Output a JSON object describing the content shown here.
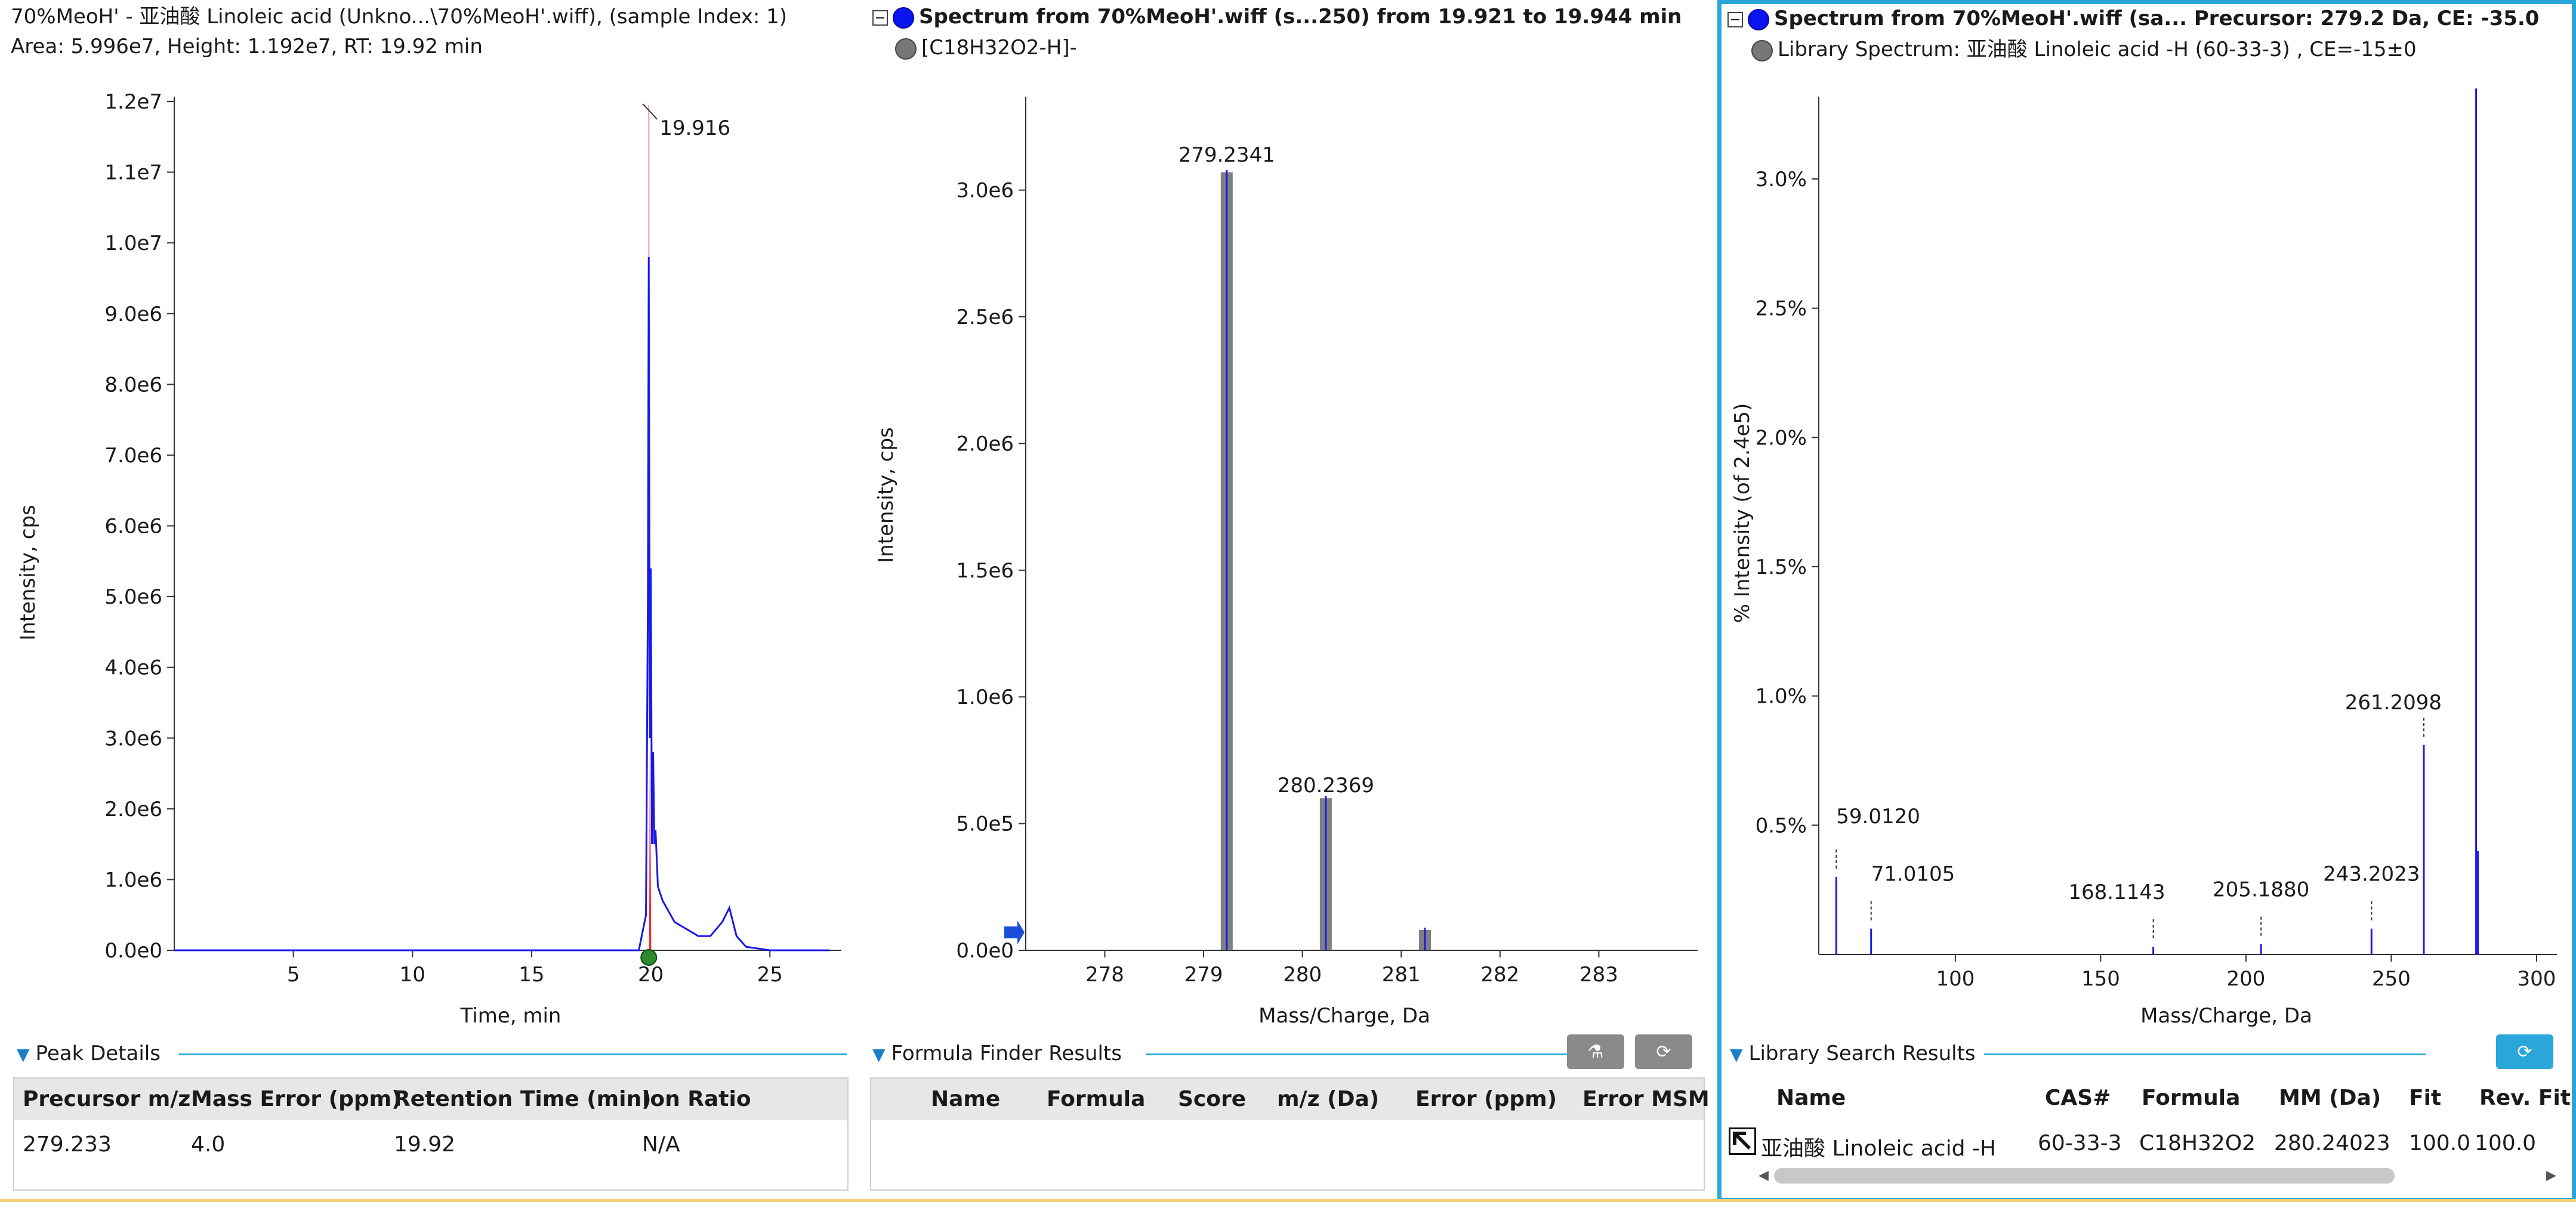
{
  "panel1": {
    "title_line1": "70%MeoH' - 亚油酸 Linoleic acid (Unkno...\\70%MeoH'.wiff), (sample Index: 1)",
    "title_line2": "Area: 5.996e7, Height: 1.192e7, RT: 19.92 min",
    "y_axis_label": "Intensity, cps",
    "x_axis_label": "Time, min",
    "y_ticks": [
      "0.0e0",
      "1.0e6",
      "2.0e6",
      "3.0e6",
      "4.0e6",
      "5.0e6",
      "6.0e6",
      "7.0e6",
      "8.0e6",
      "9.0e6",
      "1.0e7",
      "1.1e7",
      "1.2e7"
    ],
    "x_ticks": [
      "5",
      "10",
      "15",
      "20",
      "25"
    ],
    "peak_label": "19.916",
    "section_title": "Peak Details",
    "columns": [
      "Precursor m/z",
      "Mass Error (ppm)",
      "Retention Time (min)",
      "Ion Ratio"
    ],
    "rows": [
      [
        "279.233",
        "4.0",
        "19.92",
        "N/A"
      ]
    ]
  },
  "panel2": {
    "title": "Spectrum from 70%MeoH'.wiff (s...250) from 19.921 to 19.944 min",
    "subtitle": "[C18H32O2-H]-",
    "y_axis_label": "Intensity, cps",
    "x_axis_label": "Mass/Charge, Da",
    "y_ticks": [
      "0.0e0",
      "5.0e5",
      "1.0e6",
      "1.5e6",
      "2.0e6",
      "2.5e6",
      "3.0e6"
    ],
    "x_ticks": [
      "278",
      "279",
      "280",
      "281",
      "282",
      "283"
    ],
    "peak_labels": [
      "279.2341",
      "280.2369"
    ],
    "section_title": "Formula Finder Results",
    "columns": [
      "Name",
      "Formula",
      "Score",
      "m/z (Da)",
      "Error (ppm)",
      "Error MSMS"
    ]
  },
  "panel3": {
    "title": "Spectrum from 70%MeoH'.wiff (sa... Precursor: 279.2 Da, CE: -35.0",
    "subtitle": "Library  Spectrum: 亚油酸 Linoleic acid  -H (60-33-3) , CE=-15±0",
    "y_axis_label": "% Intensity (of 2.4e5)",
    "x_axis_label": "Mass/Charge, Da",
    "y_ticks": [
      "0.5%",
      "1.0%",
      "1.5%",
      "2.0%",
      "2.5%",
      "3.0%"
    ],
    "x_ticks": [
      "100",
      "150",
      "200",
      "250",
      "300"
    ],
    "peak_labels": [
      "59.0120",
      "71.0105",
      "168.1143",
      "205.1880",
      "243.2023",
      "261.2098"
    ],
    "section_title": "Library Search Results",
    "columns": [
      "Name",
      "CAS#",
      "Formula",
      "MM (Da)",
      "Fit",
      "Rev. Fit"
    ],
    "rows": [
      [
        "亚油酸 Linoleic acid  -H",
        "60-33-3",
        "C18H32O2",
        "280.24023",
        "100.0",
        "100.0"
      ]
    ]
  },
  "colors": {
    "accent": "#2aa7d8",
    "trace": "#1a1ae6",
    "highlight": "#ff0000",
    "bar_gray": "#808080"
  },
  "icons": {
    "formula_btn_1": "flask-icon",
    "formula_btn_2": "refresh-icon",
    "library_btn": "refresh-icon"
  },
  "chart_data": [
    {
      "type": "line",
      "title": "70%MeoH' - 亚油酸 Linoleic acid (Unkno...\\70%MeoH'.wiff), (sample Index: 1)",
      "xlabel": "Time, min",
      "ylabel": "Intensity, cps",
      "xlim": [
        0,
        28
      ],
      "ylim": [
        0,
        12000000
      ],
      "series": [
        {
          "x": [
            0,
            5,
            10,
            15,
            19.5,
            19.8,
            19.88,
            19.916,
            19.96,
            20.0,
            20.05,
            20.1,
            20.15,
            20.2,
            20.3,
            20.5,
            21,
            21.5,
            22,
            22.5,
            23,
            23.3,
            23.6,
            24,
            25,
            27.5
          ],
          "y": [
            0,
            0,
            0,
            0,
            0,
            500000,
            5000000,
            9800000,
            3000000,
            5400000,
            1500000,
            2800000,
            1500000,
            1700000,
            900000,
            700000,
            400000,
            300000,
            200000,
            200000,
            400000,
            600000,
            200000,
            50000,
            0,
            0
          ]
        }
      ],
      "annotations": [
        {
          "x": 19.916,
          "label": "19.916"
        }
      ]
    },
    {
      "type": "bar",
      "title": "Spectrum from 70%MeoH'.wiff (s...250) from 19.921 to 19.944 min",
      "xlabel": "Mass/Charge, Da",
      "ylabel": "Intensity, cps",
      "xlim": [
        277.2,
        284
      ],
      "ylim": [
        0,
        3350000
      ],
      "series": [
        {
          "name": "[C18H32O2-H]-",
          "x": [
            279.2341,
            280.2369,
            281.24
          ],
          "y": [
            3070000,
            600000,
            80000
          ]
        }
      ],
      "annotations": [
        {
          "x": 279.2341,
          "label": "279.2341"
        },
        {
          "x": 280.2369,
          "label": "280.2369"
        }
      ]
    },
    {
      "type": "bar",
      "title": "Spectrum from 70%MeoH'.wiff (sa... Precursor: 279.2 Da, CE: -35.0",
      "xlabel": "Mass/Charge, Da",
      "ylabel": "% Intensity (of 2.4e5)",
      "xlim": [
        53,
        307
      ],
      "ylim": [
        0,
        3.3
      ],
      "series": [
        {
          "x": [
            59.012,
            71.0105,
            168.1143,
            205.188,
            243.2023,
            261.2098,
            279.2,
            279.8
          ],
          "y": [
            0.3,
            0.1,
            0.03,
            0.04,
            0.1,
            0.81,
            3.35,
            0.4
          ]
        }
      ],
      "annotations": [
        {
          "x": 59.012,
          "label": "59.0120"
        },
        {
          "x": 71.0105,
          "label": "71.0105"
        },
        {
          "x": 168.1143,
          "label": "168.1143"
        },
        {
          "x": 205.188,
          "label": "205.1880"
        },
        {
          "x": 243.2023,
          "label": "243.2023"
        },
        {
          "x": 261.2098,
          "label": "261.2098"
        }
      ]
    }
  ]
}
